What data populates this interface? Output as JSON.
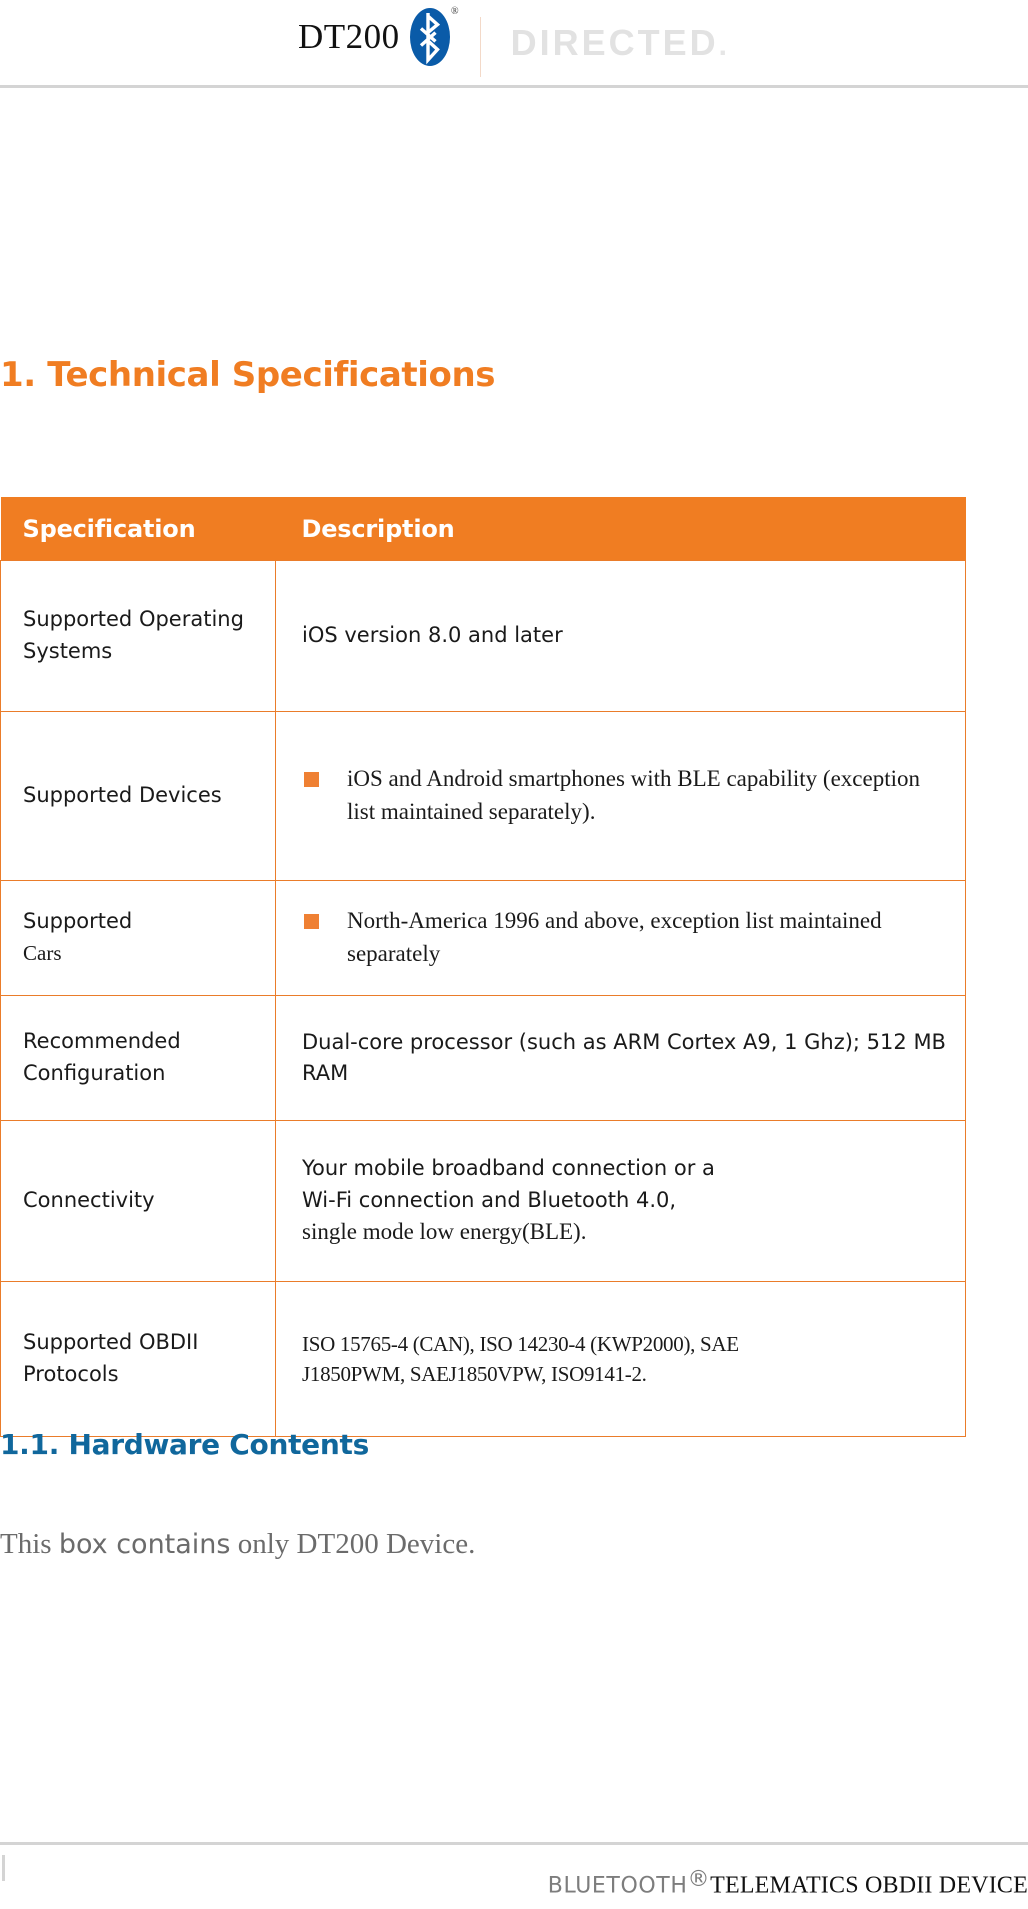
{
  "header": {
    "product_name": "DT200",
    "bluetooth_icon": "bluetooth-icon",
    "registered_mark": "®",
    "brand_name": "DIRECTED",
    "brand_dot": "."
  },
  "sections": {
    "technical_specifications_title": "1. Technical Specifications",
    "hardware_contents_title": "1.1. Hardware Contents"
  },
  "spec_table": {
    "columns": [
      "Specification",
      "Description"
    ],
    "rows": [
      {
        "specification": "Supported Operating Systems",
        "description": "iOS version 8.0 and later"
      },
      {
        "specification": "Supported Devices",
        "description": "iOS and Android smartphones with BLE capability (exception list maintained separately)."
      },
      {
        "specification_line1": "Supported",
        "specification_line2": "Cars",
        "description": "North-America 1996 and above, exception list maintained separately"
      },
      {
        "specification": "Recommended Configuration",
        "description": "Dual-core processor (such as ARM Cortex A9, 1 Ghz); 512 MB RAM"
      },
      {
        "specification": "Connectivity",
        "description_line1": "Your mobile broadband connection or a",
        "description_line2": "Wi-Fi connection and Bluetooth 4.0,",
        "description_line3": "single mode low energy(BLE)."
      },
      {
        "specification": "Supported OBDII Protocols",
        "description_line1": "ISO 15765-4 (CAN), ISO 14230-4 (KWP2000), SAE",
        "description_line2": "J1850PWM, SAEJ1850VPW, ISO9141-2."
      }
    ]
  },
  "body": {
    "hardware_sentence_seg1": "This ",
    "hardware_sentence_seg2": "box contains",
    "hardware_sentence_seg3": " only DT200 Device."
  },
  "footer": {
    "bluetooth_label": "BLUETOOTH",
    "bluetooth_reg": "®",
    "device_label": "TELEMATICS OBDII DEVICE"
  },
  "colors": {
    "accent_orange": "#f07d22",
    "accent_blue": "#10679c",
    "bluetooth_blue": "#0a5ba8",
    "brand_gray": "#e2e2e2",
    "body_gray": "#6b6b6b"
  }
}
